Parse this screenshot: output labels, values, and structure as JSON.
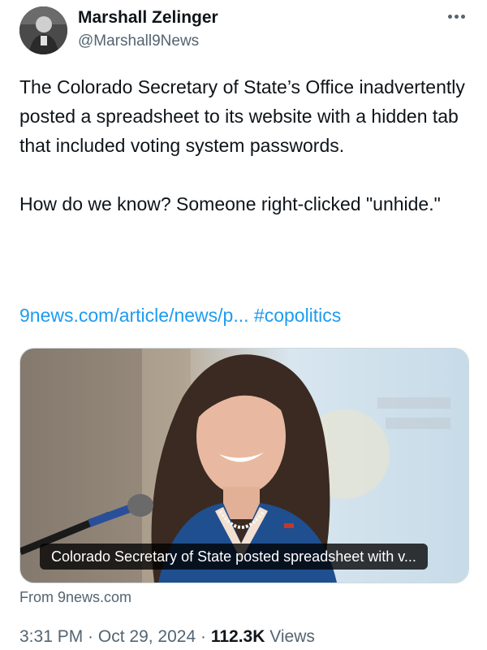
{
  "author": {
    "name": "Marshall Zelinger",
    "handle": "@Marshall9News"
  },
  "tweet": {
    "text": "The Colorado Secretary of State’s Office inadvertently posted a spreadsheet to its website with a hidden tab that included voting system passwords.\n\nHow do we know? Someone right-clicked \"unhide.\"",
    "link": "9news.com/article/news/p...",
    "hashtag": "#copolitics"
  },
  "card": {
    "caption": "Colorado Secretary of State posted spreadsheet with v...",
    "source": "From 9news.com"
  },
  "meta": {
    "time": "3:31 PM",
    "separator": " · ",
    "date": "Oct 29, 2024",
    "views_count": "112.3K",
    "views_label": "Views"
  },
  "icons": {
    "more": "more-options-icon",
    "avatar": "avatar"
  },
  "colors": {
    "link": "#1d9bf0",
    "secondary_text": "#536471",
    "primary_text": "#0f1419"
  }
}
